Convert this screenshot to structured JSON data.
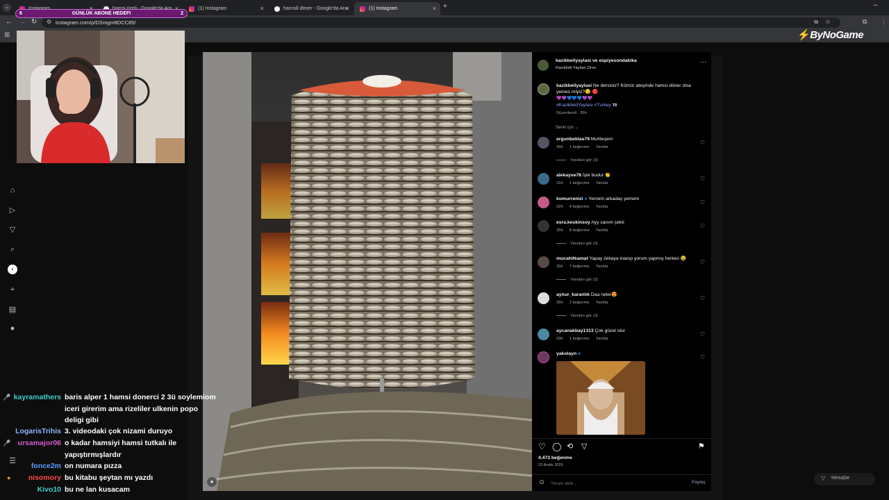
{
  "browser": {
    "tabs": [
      {
        "label": "Instagram",
        "active": false
      },
      {
        "label": "hamsi rizeli - Google'da Ara",
        "active": false
      },
      {
        "label": "(1) Instagram",
        "active": false
      },
      {
        "label": "hamsili döner - Google'da Ara",
        "active": false
      },
      {
        "label": "(1) Instagram",
        "active": true
      }
    ],
    "new_tab": "+",
    "url": "instagram.com/p/DSmgm8DCC85/"
  },
  "overlay": {
    "goal_label": "GÜNLÜK ABONE HEDEFI",
    "goal_current": "6",
    "goal_target": "2",
    "brand": "ByNoGame"
  },
  "post": {
    "author": "kazikbeliyaylasi ve espiyesondakika",
    "location": "Kazıkbeli Yaylası Zirve",
    "caption_user": "kazikbeliyaylasi",
    "caption_text": "Ne dersiniz? Kömür ateşinde hamsi döner olsa yemez miyiz?😋 🔴",
    "caption_emojis": "💜💜💙💙💙💜💜",
    "caption_tags": "#KazikbeliYaylası #Turkey",
    "caption_flag": "TR",
    "caption_meta": "Düzenlendi · 35h",
    "sort_label": "Senin için ⌄",
    "likes": "4.473 beğenme",
    "date": "23 Aralık 2025",
    "comment_placeholder": "Yorum ekle...",
    "share_label": "Paylaş",
    "messages_label": "Mesajlar"
  },
  "comments": [
    {
      "user": "ergunbektas79",
      "text": "Muhteşem",
      "time": "35h",
      "likes": "1 beğenme",
      "reply": "Yanıtla",
      "replies": "Yanıtları gör (3)"
    },
    {
      "user": "alekayse78",
      "text": "İşte budur 👏",
      "time": "31h",
      "likes": "1 beğenme",
      "reply": "Yanıtla",
      "replies": ""
    },
    {
      "user": "komurremzi",
      "text": "Yemem arkadaş yemem",
      "time": "32h",
      "likes": "4 beğenme",
      "reply": "Yanıtla",
      "replies": ""
    },
    {
      "user": "esra.keskinsoy",
      "text": "Ayy canım çekti",
      "time": "35h",
      "likes": "8 beğenme",
      "reply": "Yanıtla",
      "replies": "Yanıtları gör (3)"
    },
    {
      "user": "mucahitkamat",
      "text": "Yapay zekaya inanıp yorum yapmış herkes 😂",
      "time": "35h",
      "likes": "7 beğenme",
      "reply": "Yanıtla",
      "replies": "Yanıtları gör (3)"
    },
    {
      "user": "aynur_karanlık",
      "text": "Daa neler😍",
      "time": "35h",
      "likes": "2 beğenme",
      "reply": "Yanıtla",
      "replies": "Yanıtları gör (3)"
    },
    {
      "user": "aycanakbay1313",
      "text": "Çok güzel olur",
      "time": "33h",
      "likes": "1 beğenme",
      "reply": "Yanıtla",
      "replies": ""
    },
    {
      "user": "yakolayn",
      "text": "",
      "time": "",
      "likes": "",
      "reply": "",
      "replies": ""
    }
  ],
  "chat": [
    {
      "user": "kayramathers",
      "msg": "baris alper 1 hamsi donerci 2 3ü soylemiom iceri girerim ama rizeliler ulkenin popo deligi gibi",
      "color": "#3cd0c8"
    },
    {
      "user": "LogarisTrihis",
      "msg": "3. videodaki çok nizami duruyo",
      "color": "#8fb5ff"
    },
    {
      "user": "ursamajor06",
      "msg": "o kadar hamsiyi hamsi tutkalı ile yapıştırmışlardır",
      "color": "#d05ad0"
    },
    {
      "user": "fonce2m",
      "msg": "on numara pızza",
      "color": "#5aa0ff"
    },
    {
      "user": "nisomory",
      "msg": "bu kitabu şeytan mı yazdı",
      "color": "#ff4a4a"
    },
    {
      "user": "Kivo10",
      "msg": "bu ne lan kusacam",
      "color": "#3cd0c8"
    }
  ],
  "colors": {
    "accent": "#0095f6",
    "chrome": "#35363a",
    "ig_bg": "#000000"
  }
}
